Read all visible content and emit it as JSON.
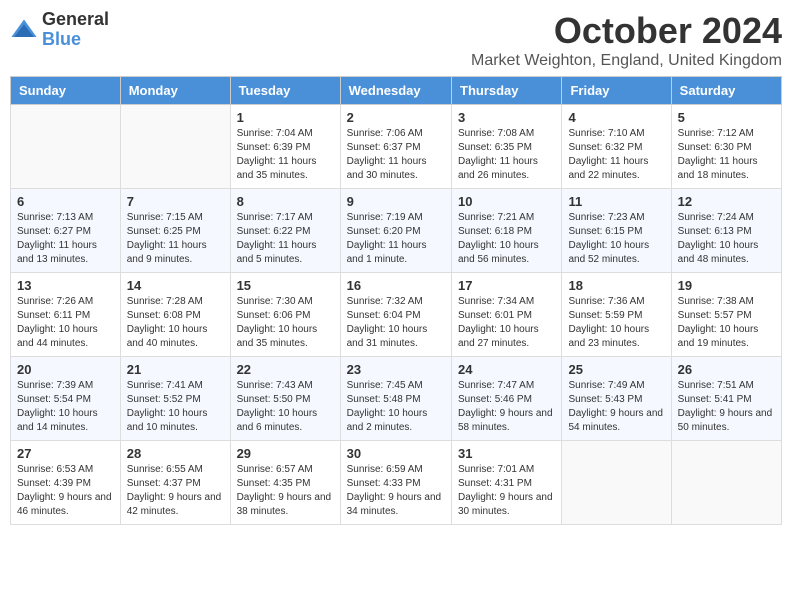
{
  "logo": {
    "general": "General",
    "blue": "Blue"
  },
  "title": "October 2024",
  "location": "Market Weighton, England, United Kingdom",
  "days_of_week": [
    "Sunday",
    "Monday",
    "Tuesday",
    "Wednesday",
    "Thursday",
    "Friday",
    "Saturday"
  ],
  "weeks": [
    [
      {
        "day": "",
        "info": ""
      },
      {
        "day": "",
        "info": ""
      },
      {
        "day": "1",
        "info": "Sunrise: 7:04 AM\nSunset: 6:39 PM\nDaylight: 11 hours and 35 minutes."
      },
      {
        "day": "2",
        "info": "Sunrise: 7:06 AM\nSunset: 6:37 PM\nDaylight: 11 hours and 30 minutes."
      },
      {
        "day": "3",
        "info": "Sunrise: 7:08 AM\nSunset: 6:35 PM\nDaylight: 11 hours and 26 minutes."
      },
      {
        "day": "4",
        "info": "Sunrise: 7:10 AM\nSunset: 6:32 PM\nDaylight: 11 hours and 22 minutes."
      },
      {
        "day": "5",
        "info": "Sunrise: 7:12 AM\nSunset: 6:30 PM\nDaylight: 11 hours and 18 minutes."
      }
    ],
    [
      {
        "day": "6",
        "info": "Sunrise: 7:13 AM\nSunset: 6:27 PM\nDaylight: 11 hours and 13 minutes."
      },
      {
        "day": "7",
        "info": "Sunrise: 7:15 AM\nSunset: 6:25 PM\nDaylight: 11 hours and 9 minutes."
      },
      {
        "day": "8",
        "info": "Sunrise: 7:17 AM\nSunset: 6:22 PM\nDaylight: 11 hours and 5 minutes."
      },
      {
        "day": "9",
        "info": "Sunrise: 7:19 AM\nSunset: 6:20 PM\nDaylight: 11 hours and 1 minute."
      },
      {
        "day": "10",
        "info": "Sunrise: 7:21 AM\nSunset: 6:18 PM\nDaylight: 10 hours and 56 minutes."
      },
      {
        "day": "11",
        "info": "Sunrise: 7:23 AM\nSunset: 6:15 PM\nDaylight: 10 hours and 52 minutes."
      },
      {
        "day": "12",
        "info": "Sunrise: 7:24 AM\nSunset: 6:13 PM\nDaylight: 10 hours and 48 minutes."
      }
    ],
    [
      {
        "day": "13",
        "info": "Sunrise: 7:26 AM\nSunset: 6:11 PM\nDaylight: 10 hours and 44 minutes."
      },
      {
        "day": "14",
        "info": "Sunrise: 7:28 AM\nSunset: 6:08 PM\nDaylight: 10 hours and 40 minutes."
      },
      {
        "day": "15",
        "info": "Sunrise: 7:30 AM\nSunset: 6:06 PM\nDaylight: 10 hours and 35 minutes."
      },
      {
        "day": "16",
        "info": "Sunrise: 7:32 AM\nSunset: 6:04 PM\nDaylight: 10 hours and 31 minutes."
      },
      {
        "day": "17",
        "info": "Sunrise: 7:34 AM\nSunset: 6:01 PM\nDaylight: 10 hours and 27 minutes."
      },
      {
        "day": "18",
        "info": "Sunrise: 7:36 AM\nSunset: 5:59 PM\nDaylight: 10 hours and 23 minutes."
      },
      {
        "day": "19",
        "info": "Sunrise: 7:38 AM\nSunset: 5:57 PM\nDaylight: 10 hours and 19 minutes."
      }
    ],
    [
      {
        "day": "20",
        "info": "Sunrise: 7:39 AM\nSunset: 5:54 PM\nDaylight: 10 hours and 14 minutes."
      },
      {
        "day": "21",
        "info": "Sunrise: 7:41 AM\nSunset: 5:52 PM\nDaylight: 10 hours and 10 minutes."
      },
      {
        "day": "22",
        "info": "Sunrise: 7:43 AM\nSunset: 5:50 PM\nDaylight: 10 hours and 6 minutes."
      },
      {
        "day": "23",
        "info": "Sunrise: 7:45 AM\nSunset: 5:48 PM\nDaylight: 10 hours and 2 minutes."
      },
      {
        "day": "24",
        "info": "Sunrise: 7:47 AM\nSunset: 5:46 PM\nDaylight: 9 hours and 58 minutes."
      },
      {
        "day": "25",
        "info": "Sunrise: 7:49 AM\nSunset: 5:43 PM\nDaylight: 9 hours and 54 minutes."
      },
      {
        "day": "26",
        "info": "Sunrise: 7:51 AM\nSunset: 5:41 PM\nDaylight: 9 hours and 50 minutes."
      }
    ],
    [
      {
        "day": "27",
        "info": "Sunrise: 6:53 AM\nSunset: 4:39 PM\nDaylight: 9 hours and 46 minutes."
      },
      {
        "day": "28",
        "info": "Sunrise: 6:55 AM\nSunset: 4:37 PM\nDaylight: 9 hours and 42 minutes."
      },
      {
        "day": "29",
        "info": "Sunrise: 6:57 AM\nSunset: 4:35 PM\nDaylight: 9 hours and 38 minutes."
      },
      {
        "day": "30",
        "info": "Sunrise: 6:59 AM\nSunset: 4:33 PM\nDaylight: 9 hours and 34 minutes."
      },
      {
        "day": "31",
        "info": "Sunrise: 7:01 AM\nSunset: 4:31 PM\nDaylight: 9 hours and 30 minutes."
      },
      {
        "day": "",
        "info": ""
      },
      {
        "day": "",
        "info": ""
      }
    ]
  ]
}
